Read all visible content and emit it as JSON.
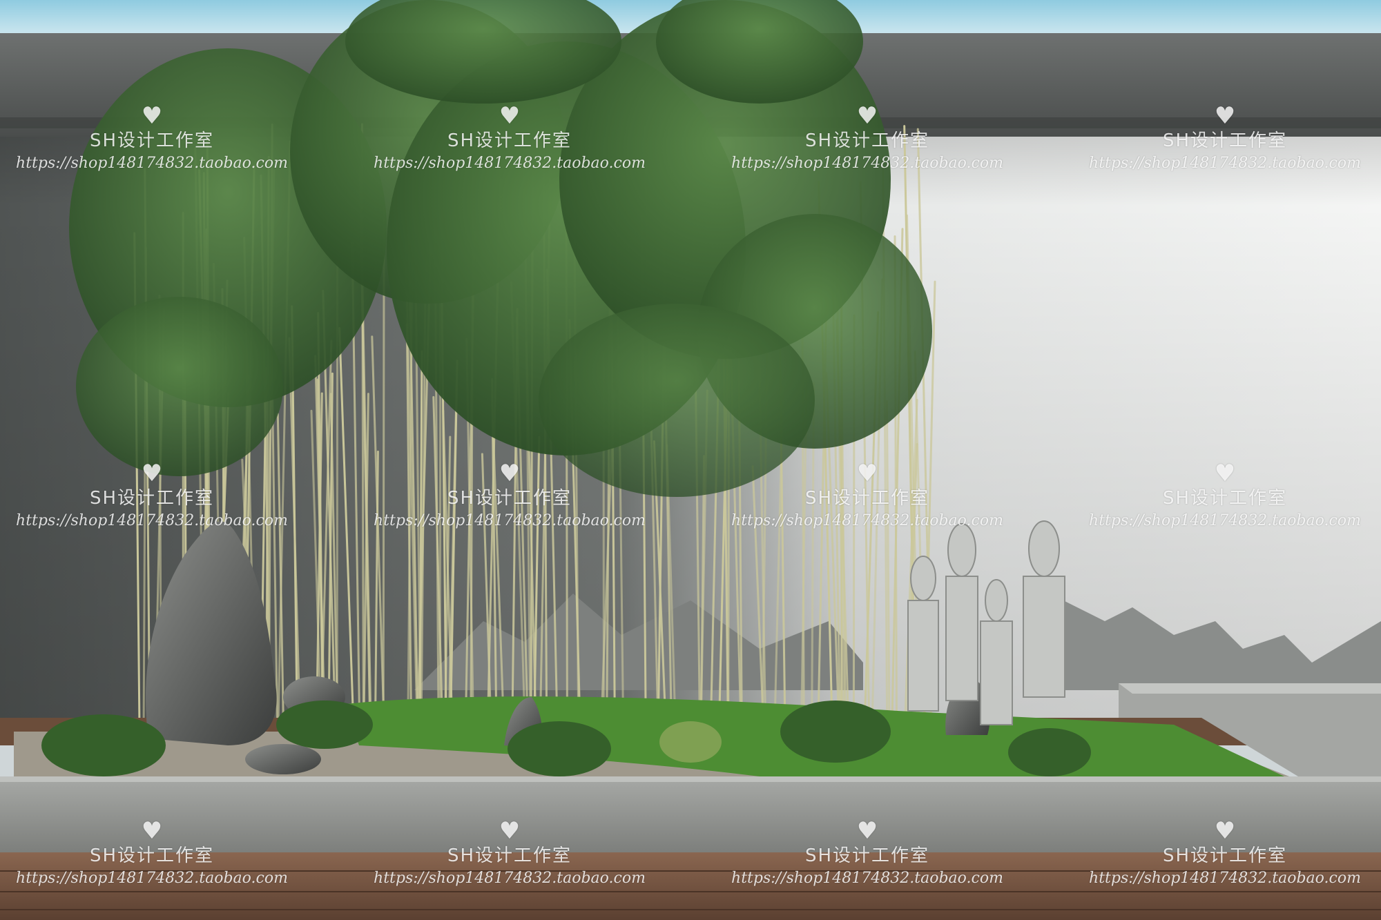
{
  "image": {
    "subject": "garden",
    "colors": {
      "sky": "#b8dbe8",
      "coping": "#5e6262",
      "wall_dark": "#6d7170",
      "wall_light": "#eef0ef",
      "bamboo_leaf": "#3f6a35",
      "bamboo_stem": "#c9c79a",
      "lawn": "#4f8f34",
      "gravel": "#a39d91",
      "concrete": "#9a9c99",
      "deck": "#7a5b46"
    }
  },
  "watermark": {
    "icon": "heart-icon",
    "heart": "♥",
    "name": "SH设计工作室",
    "url": "https://shop148174832.taobao.com"
  }
}
